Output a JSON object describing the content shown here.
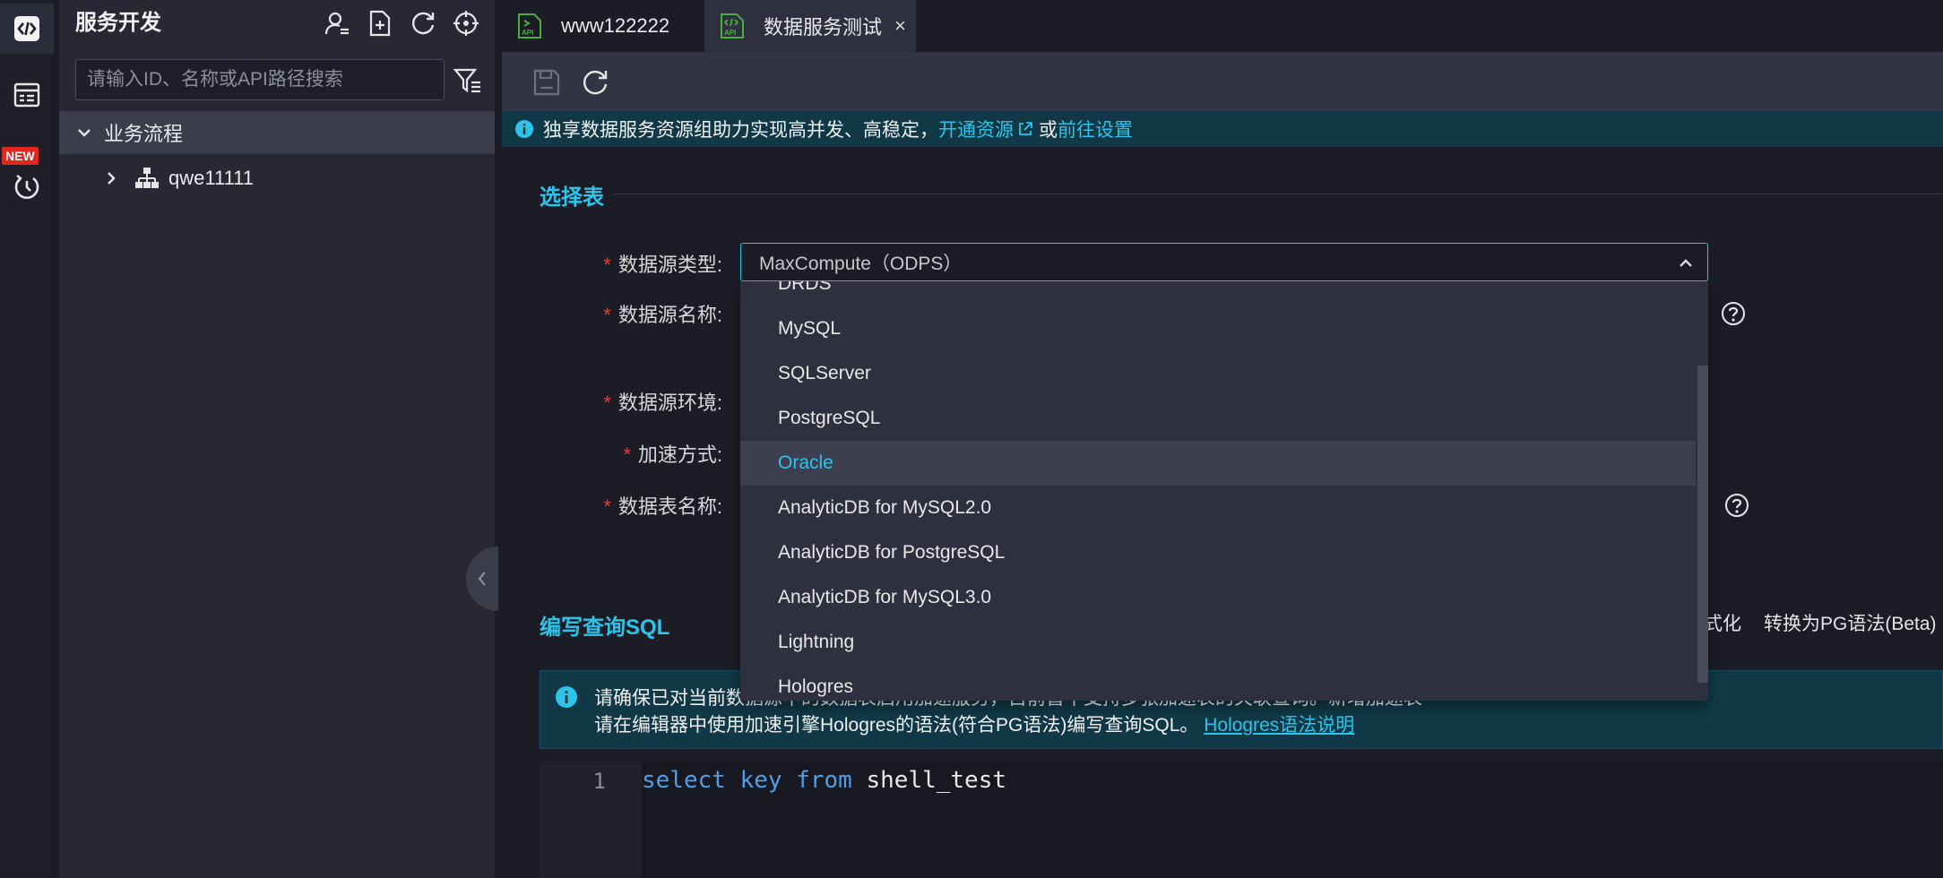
{
  "rail": {
    "new_badge": "NEW"
  },
  "panel": {
    "title": "服务开发",
    "search_placeholder": "请输入ID、名称或API路径搜索",
    "tree": {
      "root_label": "业务流程",
      "child_label": "qwe11111"
    }
  },
  "tabs": [
    {
      "label": "www122222"
    },
    {
      "label": "数据服务测试",
      "close": "×"
    }
  ],
  "notice": {
    "text": "独享数据服务资源组助力实现高并发、高稳定，",
    "link1": "开通资源",
    "connector": "或",
    "link2": "前往设置"
  },
  "select_table": {
    "section_title": "选择表",
    "fields": {
      "datasource_type": "数据源类型:",
      "datasource_name": "数据源名称:",
      "datasource_env": "数据源环境:",
      "accel_mode": "加速方式:",
      "table_name": "数据表名称:"
    },
    "required_mark": "*",
    "selected_value": "MaxCompute（ODPS）",
    "dropdown_options": [
      "DRDS",
      "MySQL",
      "SQLServer",
      "PostgreSQL",
      "Oracle",
      "AnalyticDB for MySQL2.0",
      "AnalyticDB for PostgreSQL",
      "AnalyticDB for MySQL3.0",
      "Lightning",
      "Hologres"
    ],
    "highlighted_option": "Oracle"
  },
  "sql": {
    "section_title": "编写查询SQL",
    "action_format": "格式化",
    "action_convert": "转换为PG语法(Beta)",
    "tip_line1": "请确保已对当前数据源中的数据表启用加速服务，目前暂不支持多张加速表的关联查询。新增加速表",
    "tip_line2_text": "请在编辑器中使用加速引擎Hologres的语法(符合PG语法)编写查询SQL。",
    "tip_line2_link": "Hologres语法说明",
    "line_number": "1",
    "code": {
      "kw1": "select",
      "id1": "key",
      "kw2": "from",
      "id2": "shell_test"
    }
  },
  "colors": {
    "accent": "#2ec4ea",
    "required": "#e5413a",
    "keyword": "#4c9fe8"
  }
}
